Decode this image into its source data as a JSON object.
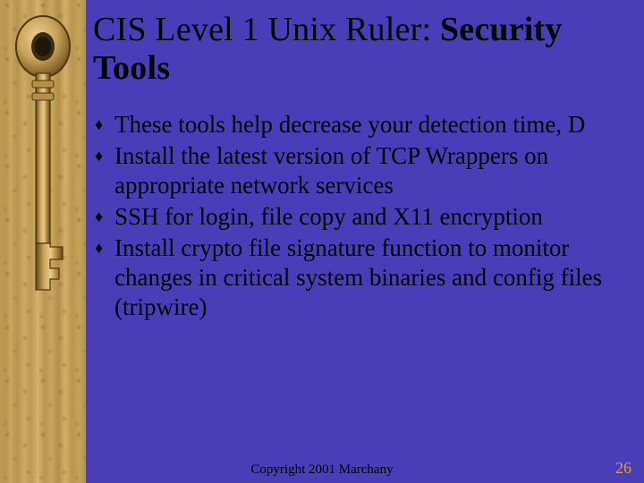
{
  "title": {
    "plain": "CIS Level 1 Unix Ruler: ",
    "strong": "Security Tools"
  },
  "bullets": [
    "These tools help decrease your detection time, D",
    "Install the latest version of TCP Wrappers on appropriate network services",
    "SSH for login, file copy and X11 encryption",
    "Install crypto file signature function to monitor changes in critical system binaries and config files (tripwire)"
  ],
  "bullet_marker": "♦",
  "footer": "Copyright 2001 Marchany",
  "page_number": "26",
  "colors": {
    "slide_bg": "#4a3db8",
    "pagenum": "#d8a13a",
    "key_metal": "#caa35a",
    "key_dark": "#6d5122"
  }
}
